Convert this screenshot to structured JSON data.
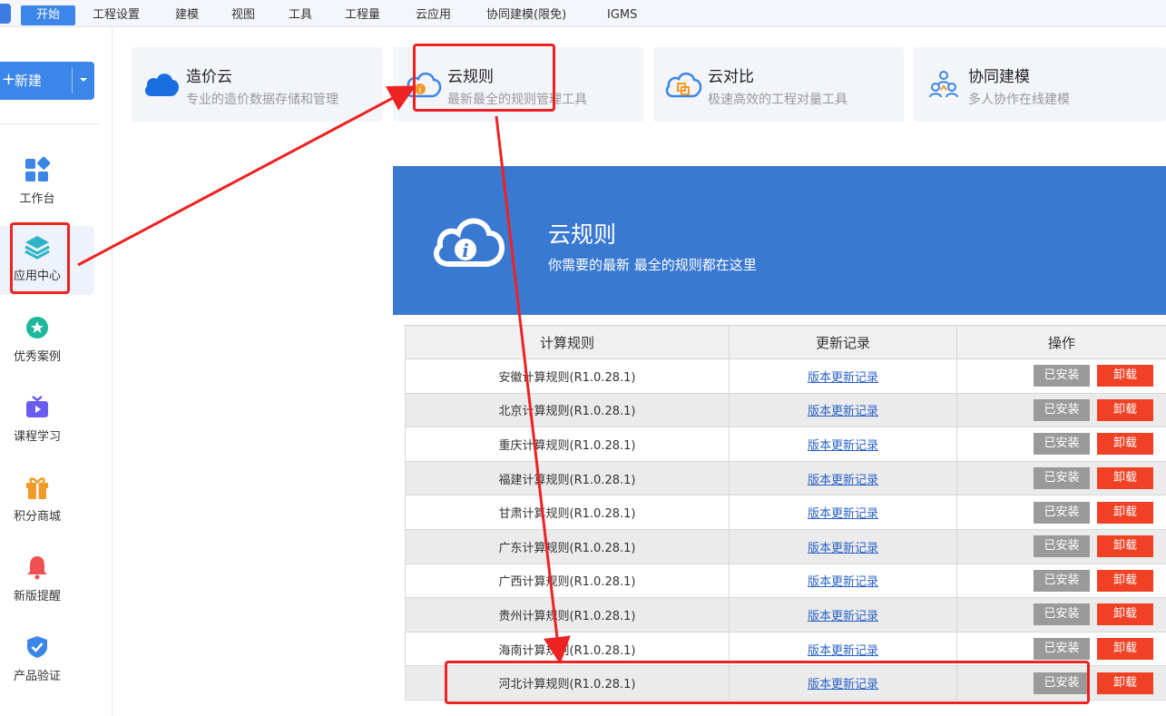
{
  "menubar": {
    "items": [
      "开始",
      "工程设置",
      "建模",
      "视图",
      "工具",
      "工程量",
      "云应用",
      "协同建模(限免)",
      "IGMS"
    ]
  },
  "sidebar": {
    "new_label": "新建",
    "items": [
      {
        "label": "工作台",
        "icon": "dashboard-icon"
      },
      {
        "label": "应用中心",
        "icon": "layers-icon"
      },
      {
        "label": "优秀案例",
        "icon": "star-badge-icon"
      },
      {
        "label": "课程学习",
        "icon": "tv-icon"
      },
      {
        "label": "积分商城",
        "icon": "gift-icon"
      },
      {
        "label": "新版提醒",
        "icon": "bell-icon"
      },
      {
        "label": "产品验证",
        "icon": "shield-check-icon"
      }
    ]
  },
  "cards": [
    {
      "title": "造价云",
      "subtitle": "专业的造价数据存储和管理",
      "icon": "cloud-icon"
    },
    {
      "title": "云规则",
      "subtitle": "最新最全的规则管理工具",
      "icon": "cloud-info-icon"
    },
    {
      "title": "云对比",
      "subtitle": "极速高效的工程对量工具",
      "icon": "cloud-compare-icon"
    },
    {
      "title": "协同建模",
      "subtitle": "多人协作在线建模",
      "icon": "people-icon"
    }
  ],
  "panel": {
    "title": "云规则",
    "subtitle": "你需要的最新 最全的规则都在这里"
  },
  "table": {
    "headers": [
      "计算规则",
      "更新记录",
      "操作"
    ],
    "rows": [
      {
        "name": "安徽计算规则(R1.0.28.1)",
        "log": "版本更新记录",
        "installed": "已安装",
        "uninstall": "卸载"
      },
      {
        "name": "北京计算规则(R1.0.28.1)",
        "log": "版本更新记录",
        "installed": "已安装",
        "uninstall": "卸载"
      },
      {
        "name": "重庆计算规则(R1.0.28.1)",
        "log": "版本更新记录",
        "installed": "已安装",
        "uninstall": "卸载"
      },
      {
        "name": "福建计算规则(R1.0.28.1)",
        "log": "版本更新记录",
        "installed": "已安装",
        "uninstall": "卸载"
      },
      {
        "name": "甘肃计算规则(R1.0.28.1)",
        "log": "版本更新记录",
        "installed": "已安装",
        "uninstall": "卸载"
      },
      {
        "name": "广东计算规则(R1.0.28.1)",
        "log": "版本更新记录",
        "installed": "已安装",
        "uninstall": "卸载"
      },
      {
        "name": "广西计算规则(R1.0.28.1)",
        "log": "版本更新记录",
        "installed": "已安装",
        "uninstall": "卸载"
      },
      {
        "name": "贵州计算规则(R1.0.28.1)",
        "log": "版本更新记录",
        "installed": "已安装",
        "uninstall": "卸载"
      },
      {
        "name": "海南计算规则(R1.0.28.1)",
        "log": "版本更新记录",
        "installed": "已安装",
        "uninstall": "卸载"
      },
      {
        "name": "河北计算规则(R1.0.28.1)",
        "log": "版本更新记录",
        "installed": "已安装",
        "uninstall": "卸载"
      }
    ]
  },
  "colors": {
    "primary": "#3b86e8",
    "banner": "#3a79d2",
    "uninstall": "#f04124",
    "installed": "#9a9a9a",
    "annotation": "#ee2222"
  }
}
